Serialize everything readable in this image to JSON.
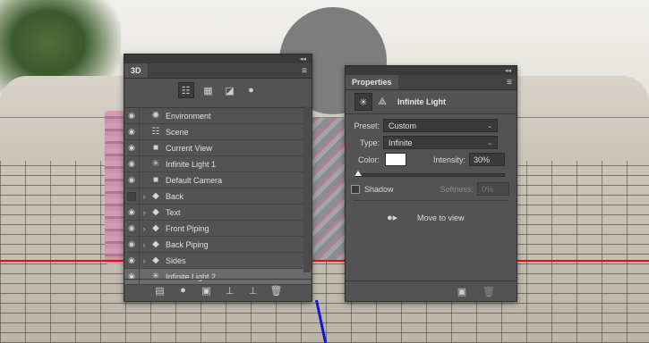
{
  "panel_3d": {
    "tab_label": "3D",
    "collapse_glyph": "◂◂",
    "close_glyph": "✕",
    "menu_glyph": "≡",
    "toolbar": [
      {
        "icon": "scene-filter-icon",
        "glyph": "☷",
        "active": true
      },
      {
        "icon": "mesh-filter-icon",
        "glyph": "▦",
        "active": false
      },
      {
        "icon": "material-filter-icon",
        "glyph": "◪",
        "active": false
      },
      {
        "icon": "light-filter-icon",
        "glyph": "●",
        "active": false
      }
    ],
    "layers": [
      {
        "name": "Environment",
        "icon": "environment-icon",
        "glyph": "✺",
        "visible": true,
        "expandable": false,
        "selected": false
      },
      {
        "name": "Scene",
        "icon": "scene-icon",
        "glyph": "☷",
        "visible": true,
        "expandable": false,
        "selected": false
      },
      {
        "name": "Current View",
        "icon": "camera-icon",
        "glyph": "■",
        "visible": true,
        "expandable": false,
        "selected": false
      },
      {
        "name": "Infinite Light 1",
        "icon": "infinite-light-icon",
        "glyph": "✳",
        "visible": true,
        "expandable": false,
        "selected": false
      },
      {
        "name": "Default Camera",
        "icon": "camera-icon",
        "glyph": "■",
        "visible": true,
        "expandable": false,
        "selected": false
      },
      {
        "name": "Back",
        "icon": "mesh-icon",
        "glyph": "◆",
        "visible": false,
        "expandable": true,
        "selected": false
      },
      {
        "name": "Text",
        "icon": "mesh-icon",
        "glyph": "◆",
        "visible": true,
        "expandable": true,
        "selected": false
      },
      {
        "name": "Front Piping",
        "icon": "mesh-icon",
        "glyph": "◆",
        "visible": true,
        "expandable": true,
        "selected": false
      },
      {
        "name": "Back Piping",
        "icon": "mesh-icon",
        "glyph": "◆",
        "visible": true,
        "expandable": true,
        "selected": false
      },
      {
        "name": "Sides",
        "icon": "mesh-icon",
        "glyph": "◆",
        "visible": true,
        "expandable": true,
        "selected": false
      },
      {
        "name": "Infinite Light 2",
        "icon": "infinite-light-icon",
        "glyph": "✳",
        "visible": true,
        "expandable": false,
        "selected": true
      }
    ],
    "bottom_icons": [
      {
        "icon": "render-icon",
        "glyph": "▤"
      },
      {
        "icon": "add-light-icon",
        "glyph": "●"
      },
      {
        "icon": "new-mesh-icon",
        "glyph": "▣"
      },
      {
        "icon": "move-to-ground-icon",
        "glyph": "⊥"
      },
      {
        "icon": "move-to-view-icon",
        "glyph": "⊥"
      },
      {
        "icon": "trash-icon",
        "glyph": "🗑"
      }
    ]
  },
  "panel_properties": {
    "tab_label": "Properties",
    "collapse_glyph": "◂◂",
    "close_glyph": "✕",
    "menu_glyph": "≡",
    "title": "Infinite Light",
    "preset_label": "Preset:",
    "preset_value": "Custom",
    "type_label": "Type:",
    "type_value": "Infinite",
    "color_label": "Color:",
    "light_color": "#ffffff",
    "intensity_label": "Intensity:",
    "intensity_value": "30%",
    "intensity_fraction": 0.3,
    "shadow_label": "Shadow",
    "shadow_checked": false,
    "softness_label": "Softness:",
    "softness_value": "0%",
    "move_to_view_label": "Move to view"
  }
}
